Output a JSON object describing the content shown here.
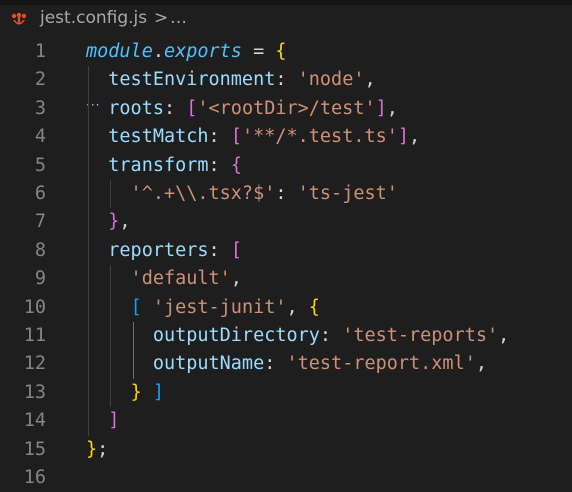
{
  "breadcrumb": {
    "file_icon": "jest-icon",
    "file_name": "jest.config.js",
    "separator": ">",
    "more": "…"
  },
  "editor": {
    "line_numbers": [
      "1",
      "2",
      "3",
      "4",
      "5",
      "6",
      "7",
      "8",
      "9",
      "10",
      "11",
      "12",
      "13",
      "14",
      "15",
      "16"
    ],
    "lines": [
      [
        {
          "t": "module",
          "c": "t-module"
        },
        {
          "t": ".",
          "c": "t-dot"
        },
        {
          "t": "exports",
          "c": "t-exports"
        },
        {
          "t": " = ",
          "c": "t-op"
        },
        {
          "t": "{",
          "c": "t-brace1"
        }
      ],
      [
        {
          "t": "  testEnvironment",
          "c": "t-prop"
        },
        {
          "t": ": ",
          "c": "t-punc"
        },
        {
          "t": "'node'",
          "c": "t-str"
        },
        {
          "t": ",",
          "c": "t-punc"
        }
      ],
      [
        {
          "t": "  roots",
          "c": "t-prop"
        },
        {
          "t": ": ",
          "c": "t-punc"
        },
        {
          "t": "[",
          "c": "t-brace2"
        },
        {
          "t": "'<rootDir>/test'",
          "c": "t-str"
        },
        {
          "t": "]",
          "c": "t-brace2"
        },
        {
          "t": ",",
          "c": "t-punc"
        }
      ],
      [
        {
          "t": "  testMatch",
          "c": "t-prop"
        },
        {
          "t": ": ",
          "c": "t-punc"
        },
        {
          "t": "[",
          "c": "t-brace2"
        },
        {
          "t": "'**/*.test.ts'",
          "c": "t-str"
        },
        {
          "t": "]",
          "c": "t-brace2"
        },
        {
          "t": ",",
          "c": "t-punc"
        }
      ],
      [
        {
          "t": "  transform",
          "c": "t-prop"
        },
        {
          "t": ": ",
          "c": "t-punc"
        },
        {
          "t": "{",
          "c": "t-brace2"
        }
      ],
      [
        {
          "t": "    '^.+\\\\.tsx?$'",
          "c": "t-str"
        },
        {
          "t": ": ",
          "c": "t-punc"
        },
        {
          "t": "'ts-jest'",
          "c": "t-str"
        }
      ],
      [
        {
          "t": "  ",
          "c": "t-punc"
        },
        {
          "t": "}",
          "c": "t-brace2"
        },
        {
          "t": ",",
          "c": "t-punc"
        }
      ],
      [
        {
          "t": "  reporters",
          "c": "t-prop"
        },
        {
          "t": ": ",
          "c": "t-punc"
        },
        {
          "t": "[",
          "c": "t-brace2"
        }
      ],
      [
        {
          "t": "    'default'",
          "c": "t-str"
        },
        {
          "t": ",",
          "c": "t-punc"
        }
      ],
      [
        {
          "t": "    ",
          "c": "t-punc"
        },
        {
          "t": "[",
          "c": "t-brace3"
        },
        {
          "t": " ",
          "c": "t-punc"
        },
        {
          "t": "'jest-junit'",
          "c": "t-str"
        },
        {
          "t": ", ",
          "c": "t-punc"
        },
        {
          "t": "{",
          "c": "t-brace1"
        }
      ],
      [
        {
          "t": "      outputDirectory",
          "c": "t-prop"
        },
        {
          "t": ": ",
          "c": "t-punc"
        },
        {
          "t": "'test-reports'",
          "c": "t-str"
        },
        {
          "t": ",",
          "c": "t-punc"
        }
      ],
      [
        {
          "t": "      outputName",
          "c": "t-prop"
        },
        {
          "t": ": ",
          "c": "t-punc"
        },
        {
          "t": "'test-report.xml'",
          "c": "t-str"
        },
        {
          "t": ",",
          "c": "t-punc"
        }
      ],
      [
        {
          "t": "    ",
          "c": "t-punc"
        },
        {
          "t": "}",
          "c": "t-brace1"
        },
        {
          "t": " ",
          "c": "t-punc"
        },
        {
          "t": "]",
          "c": "t-brace3"
        }
      ],
      [
        {
          "t": "  ",
          "c": "t-punc"
        },
        {
          "t": "]",
          "c": "t-brace2"
        }
      ],
      [
        {
          "t": "}",
          "c": "t-brace1"
        },
        {
          "t": ";",
          "c": "t-punc"
        }
      ],
      []
    ]
  },
  "colors": {
    "background": "#1e1e1e",
    "keyword": "#4fc1ff",
    "property": "#9cdcfe",
    "string": "#ce9178",
    "bracket_gold": "#ffd700",
    "bracket_pink": "#da70d6",
    "bracket_blue": "#179fff",
    "line_number": "#858585"
  }
}
